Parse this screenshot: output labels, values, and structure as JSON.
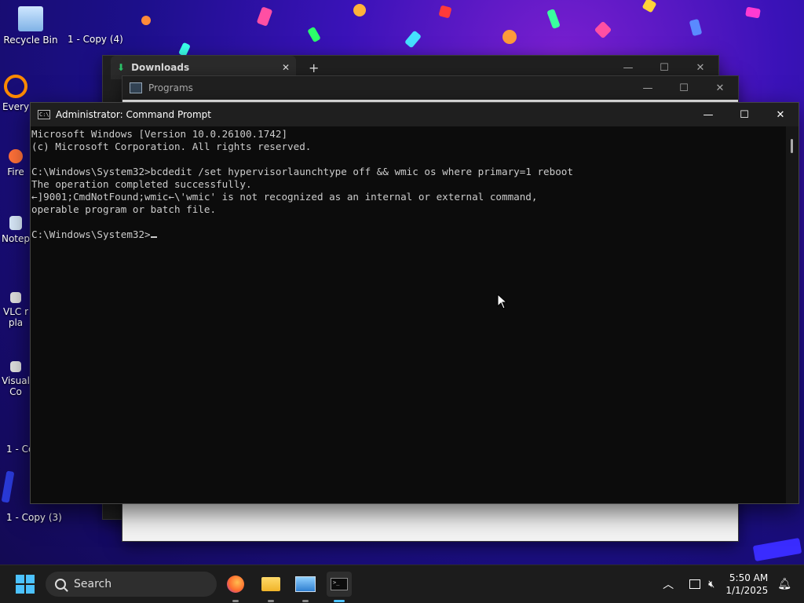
{
  "desktop": {
    "icons": [
      {
        "label": "Recycle Bin"
      },
      {
        "label": "1 - Copy (4)"
      },
      {
        "label": "Every"
      },
      {
        "label": "Fire"
      },
      {
        "label": "Notep"
      },
      {
        "label": "VLC r"
      },
      {
        "label": "pla"
      },
      {
        "label": "Visual"
      },
      {
        "label": "Co"
      },
      {
        "label": "1 - Co"
      },
      {
        "label": "1 - Copy (3)"
      }
    ]
  },
  "windows": {
    "downloads": {
      "title": "Downloads",
      "new_tab": "+",
      "close_tab": "✕"
    },
    "programs": {
      "title": "Programs"
    },
    "cmd": {
      "title": "Administrator: Command Prompt",
      "lines": [
        "Microsoft Windows [Version 10.0.26100.1742]",
        "(c) Microsoft Corporation. All rights reserved.",
        "",
        "C:\\Windows\\System32>bcdedit /set hypervisorlaunchtype off && wmic os where primary=1 reboot",
        "The operation completed successfully.",
        "←]9001;CmdNotFound;wmic←\\'wmic' is not recognized as an internal or external command,",
        "operable program or batch file.",
        ""
      ],
      "prompt": "C:\\Windows\\System32>"
    }
  },
  "taskbar": {
    "search_placeholder": "Search",
    "apps": [
      "firefox-icon",
      "file-explorer-icon",
      "control-panel-icon",
      "terminal-icon"
    ],
    "time": "5:50 AM",
    "date": "1/1/2025"
  },
  "colors": {
    "accent": "#4cc2ff",
    "console_bg": "#0c0c0c",
    "console_text": "#cccccc"
  }
}
